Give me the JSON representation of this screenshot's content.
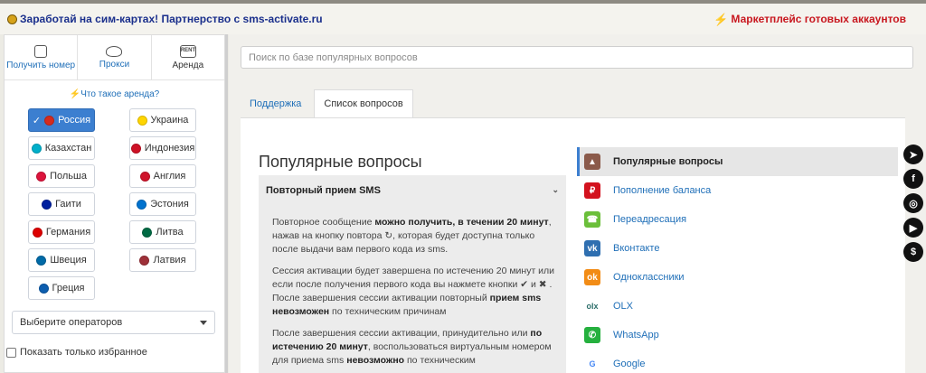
{
  "topbar": {
    "promo_left": "Заработай на сим-картах! Партнерство с sms-activate.ru",
    "promo_right": "Маркетплейс готовых аккаунтов"
  },
  "sidebar": {
    "nav": [
      {
        "label": "Получить номер",
        "icon": "phone-icon"
      },
      {
        "label": "Прокси",
        "icon": "cloud-icon"
      },
      {
        "label": "Аренда",
        "icon": "rent-icon"
      }
    ],
    "whatis": "Что такое аренда?",
    "countries": [
      {
        "label": "Россия",
        "active": true,
        "flag": "#d52b1e"
      },
      {
        "label": "Украина",
        "active": false,
        "flag": "#ffd500"
      },
      {
        "label": "Казахстан",
        "active": false,
        "flag": "#00afca"
      },
      {
        "label": "Индонезия",
        "active": false,
        "flag": "#ce1126"
      },
      {
        "label": "Польша",
        "active": false,
        "flag": "#dc143c"
      },
      {
        "label": "Англия",
        "active": false,
        "flag": "#cf142b"
      },
      {
        "label": "Гаити",
        "active": false,
        "flag": "#00209f"
      },
      {
        "label": "Эстония",
        "active": false,
        "flag": "#0072ce"
      },
      {
        "label": "Германия",
        "active": false,
        "flag": "#dd0000"
      },
      {
        "label": "Литва",
        "active": false,
        "flag": "#006a44"
      },
      {
        "label": "Швеция",
        "active": false,
        "flag": "#006aa7"
      },
      {
        "label": "Латвия",
        "active": false,
        "flag": "#9e3039"
      },
      {
        "label": "Греция",
        "active": false,
        "flag": "#0d5eaf"
      }
    ],
    "operator_select": "Выберите операторов",
    "favorites_label": "Показать только избранное"
  },
  "main": {
    "search_placeholder": "Поиск по базе популярных вопросов",
    "tabs": [
      {
        "label": "Поддержка",
        "active": false
      },
      {
        "label": "Список вопросов",
        "active": true
      }
    ],
    "section_title": "Популярные вопросы",
    "accordion": {
      "title": "Повторный прием SMS",
      "p1_a": "Повторное сообщение ",
      "p1_b": "можно получить, в течении 20 минут",
      "p1_c": ", нажав на кнопку повтора ↻, которая будет доступна только после выдачи вам первого кода из sms.",
      "p2_a": "Сессия активации будет завершена по истечению 20 минут или если после получения первого кода вы нажмете кнопки ✔ и ✖ . После завершения сессии активации повторный ",
      "p2_b": "прием sms невозможен",
      "p2_c": " по техническим причинам",
      "p3_a": "После завершения сессии активации, принудительно или ",
      "p3_b": "по истечению 20 минут",
      "p3_c": ", воспользоваться виртуальным номером для приема sms ",
      "p3_d": "невозможно",
      "p3_e": " по техническим"
    },
    "categories": [
      {
        "label": "Популярные вопросы",
        "active": true,
        "icon": "user-icon",
        "color": "#8b5a4a"
      },
      {
        "label": "Пополнение баланса",
        "active": false,
        "icon": "ruble-icon",
        "color": "#d3121e"
      },
      {
        "label": "Переадресация",
        "active": false,
        "icon": "call-forward-icon",
        "color": "#6bbf3a"
      },
      {
        "label": "Вконтакте",
        "active": false,
        "icon": "vk-icon",
        "color": "#2f6fb0"
      },
      {
        "label": "Одноклассники",
        "active": false,
        "icon": "ok-icon",
        "color": "#f28c16"
      },
      {
        "label": "OLX",
        "active": false,
        "icon": "olx-icon",
        "color": "#ffffff"
      },
      {
        "label": "WhatsApp",
        "active": false,
        "icon": "whatsapp-icon",
        "color": "#25b03e"
      },
      {
        "label": "Google",
        "active": false,
        "icon": "google-icon",
        "color": "#ffffff"
      }
    ]
  },
  "social": [
    "telegram-icon",
    "facebook-icon",
    "wechat-icon",
    "youtube-icon",
    "dollar-icon"
  ]
}
